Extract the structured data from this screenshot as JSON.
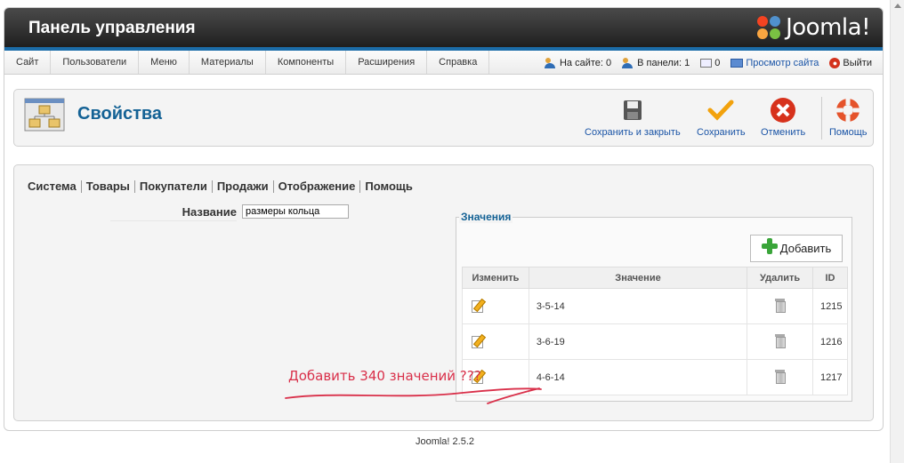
{
  "header": {
    "title": "Панель управления",
    "logo_text": "Joomla!"
  },
  "menu": {
    "items": [
      "Сайт",
      "Пользователи",
      "Меню",
      "Материалы",
      "Компоненты",
      "Расширения",
      "Справка"
    ]
  },
  "status": {
    "online_site": "На сайте: 0",
    "online_admin": "В панели: 1",
    "messages": "0",
    "view_site": "Просмотр сайта",
    "logout": "Выйти"
  },
  "toolbar": {
    "page_title": "Свойства",
    "save_close": "Сохранить и закрыть",
    "save": "Сохранить",
    "cancel": "Отменить",
    "help": "Помощь"
  },
  "tabs": [
    "Система",
    "Товары",
    "Покупатели",
    "Продажи",
    "Отображение",
    "Помощь"
  ],
  "form": {
    "name_label": "Название",
    "name_value": "размеры кольца"
  },
  "values": {
    "legend": "Значения",
    "add_label": "Добавить",
    "columns": {
      "edit": "Изменить",
      "value": "Значение",
      "delete": "Удалить",
      "id": "ID"
    },
    "rows": [
      {
        "value": "3-5-14",
        "id": "1215"
      },
      {
        "value": "3-6-19",
        "id": "1216"
      },
      {
        "value": "4-6-14",
        "id": "1217"
      }
    ]
  },
  "annotation": "Добавить 340 значений ???",
  "footer": "Joomla! 2.5.2",
  "colors": {
    "accent_blue": "#146295",
    "annotation_red": "#d9304a",
    "header_bar": "#1b6ca8"
  }
}
